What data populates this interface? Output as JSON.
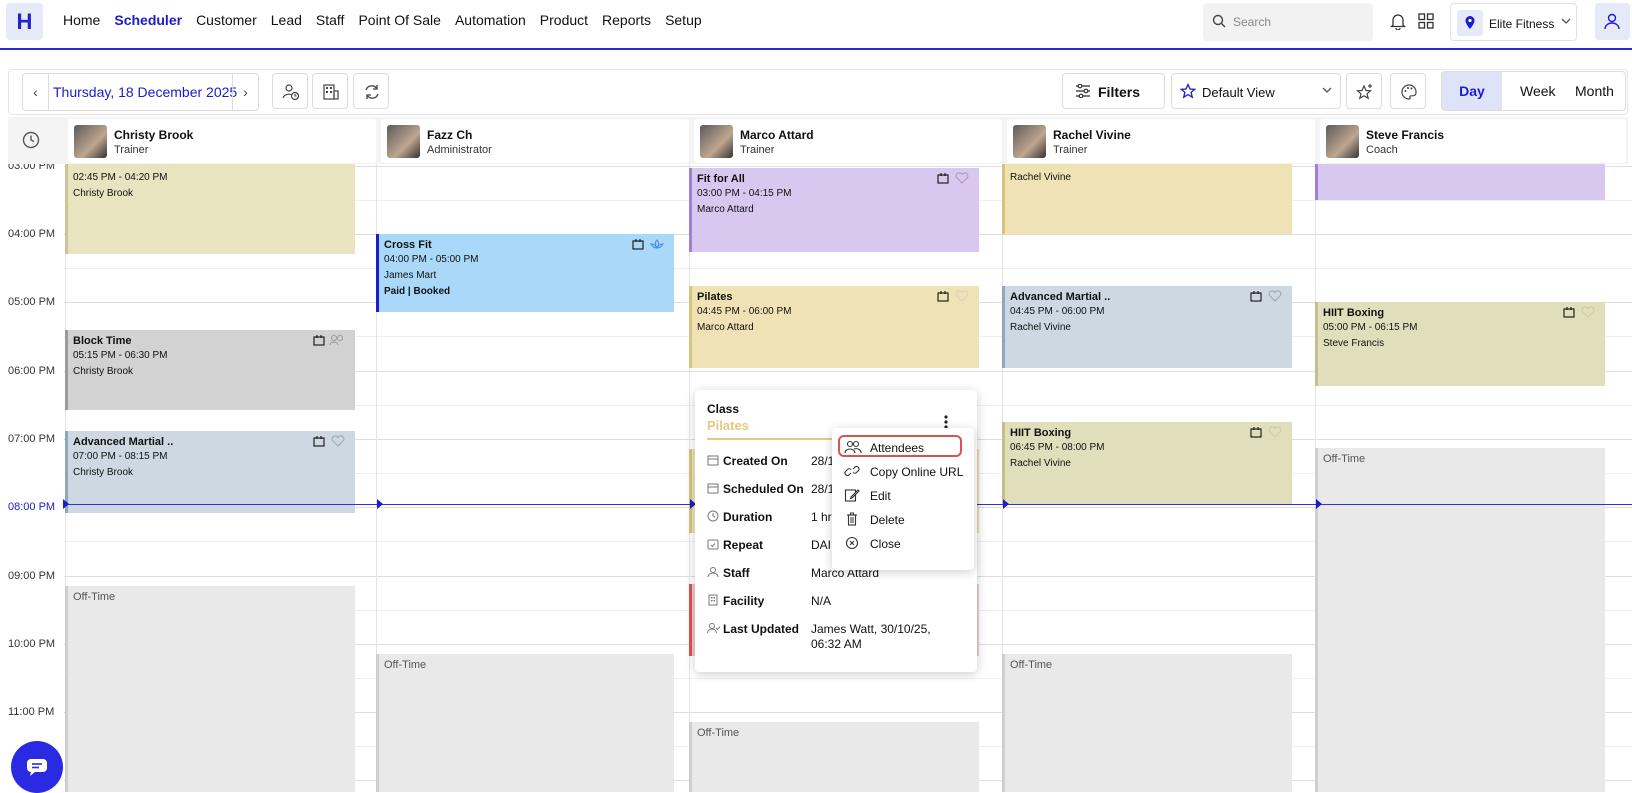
{
  "nav": {
    "logo": "H",
    "items": [
      "Home",
      "Scheduler",
      "Customer",
      "Lead",
      "Staff",
      "Point Of Sale",
      "Automation",
      "Product",
      "Reports",
      "Setup"
    ],
    "active": "Scheduler",
    "search_placeholder": "Search",
    "location": "Elite Fitness",
    "accent": "#1b1bd0"
  },
  "toolbar": {
    "date": "Thursday, 18 December 2025",
    "filters": "Filters",
    "view": "Default View",
    "tabs": [
      "Day",
      "Week",
      "Month"
    ],
    "active_tab": "Day"
  },
  "staff": [
    {
      "name": "Christy Brook",
      "role": "Trainer"
    },
    {
      "name": "Fazz Ch",
      "role": "Administrator"
    },
    {
      "name": "Marco Attard",
      "role": "Trainer"
    },
    {
      "name": "Rachel Vivine",
      "role": "Trainer"
    },
    {
      "name": "Steve Francis",
      "role": "Coach"
    }
  ],
  "times": [
    "03:00 PM",
    "04:00 PM",
    "05:00 PM",
    "06:00 PM",
    "07:00 PM",
    "08:00 PM",
    "09:00 PM",
    "10:00 PM",
    "11:00 PM"
  ],
  "events": {
    "c1a": {
      "time": "02:45 PM - 04:20 PM",
      "who": "Christy Brook"
    },
    "c1b": {
      "title": "Block Time",
      "time": "05:15 PM - 06:30 PM",
      "who": "Christy Brook"
    },
    "c1c": {
      "title": "Advanced Martial ..",
      "time": "07:00 PM - 08:15 PM",
      "who": "Christy Brook"
    },
    "c2a": {
      "title": "Cross Fit",
      "time": "04:00 PM - 05:00 PM",
      "who": "James Mart",
      "status": "Paid | Booked"
    },
    "c3a": {
      "title": "Fit for All",
      "time": "03:00 PM - 04:15 PM",
      "who": "Marco Attard"
    },
    "c3b": {
      "title": "Pilates",
      "time": "04:45 PM - 06:00 PM",
      "who": "Marco Attard"
    },
    "c4a": {
      "who": "Rachel Vivine"
    },
    "c4b": {
      "title": "Advanced Martial ..",
      "time": "04:45 PM - 06:00 PM",
      "who": "Rachel Vivine"
    },
    "c4c": {
      "title": "HIIT Boxing",
      "time": "06:45 PM - 08:00 PM",
      "who": "Rachel Vivine"
    },
    "c5b": {
      "title": "HIIT Boxing",
      "time": "05:00 PM - 06:15 PM",
      "who": "Steve Francis"
    }
  },
  "offtime": "Off-Time",
  "popover": {
    "kind": "Class",
    "name": "Pilates",
    "rows": [
      {
        "k": "Created On",
        "v": "28/1"
      },
      {
        "k": "Scheduled On",
        "v": "28/1"
      },
      {
        "k": "Duration",
        "v": "1 hr"
      },
      {
        "k": "Repeat",
        "v": "DAI"
      },
      {
        "k": "Staff",
        "v": "Marco Attard"
      },
      {
        "k": "Facility",
        "v": "N/A"
      },
      {
        "k": "Last Updated",
        "v": "James Watt, 30/10/25, 06:32 AM"
      }
    ]
  },
  "context_menu": [
    "Attendees",
    "Copy Online URL",
    "Edit",
    "Delete",
    "Close"
  ],
  "colors": {
    "olive": "#e7e4bf",
    "blue": "#aad8f8",
    "purple": "#d8c8ef",
    "yellow": "#efe3b5",
    "slate": "#cdd8e3",
    "gray": "#d2d2d2",
    "olive2": "#e1dfbb"
  }
}
